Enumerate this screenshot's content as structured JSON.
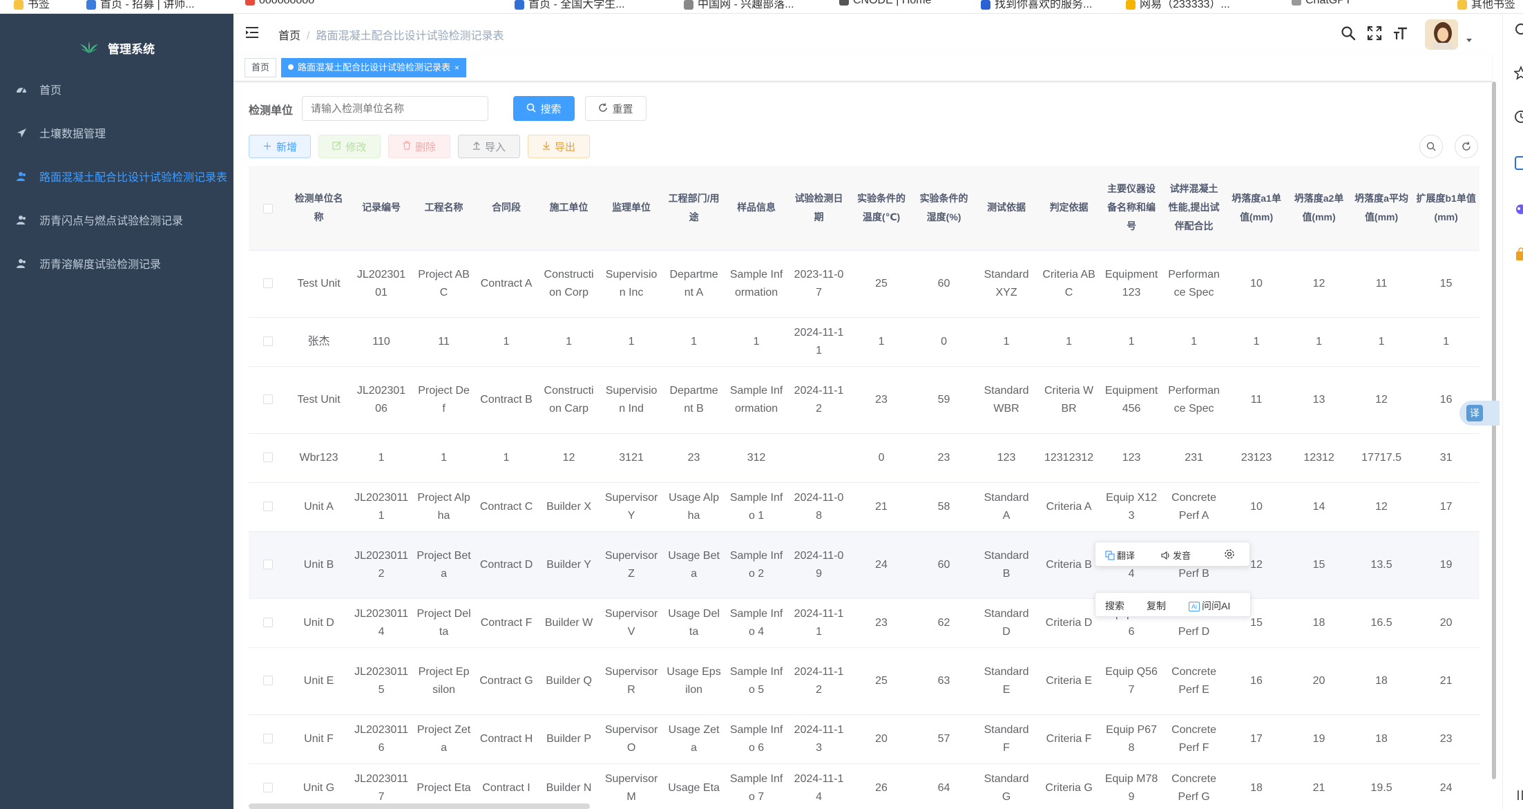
{
  "browser": {
    "bookmarks": [
      "书签",
      "首页 - 招募 | 讲师...",
      "ooooooooo",
      "首页 - 全国大学生...",
      "中国网 - 兴趣部落...",
      "CNODE | Home",
      "找到你喜欢的服务...",
      "网易（233333）...",
      "ChatGPT",
      "其他书签"
    ]
  },
  "sidebar": {
    "logo_text": "管理系统",
    "items": [
      {
        "label": "首页",
        "icon": "dashboard-icon"
      },
      {
        "label": "土壤数据管理",
        "icon": "send-icon"
      },
      {
        "label": "路面混凝土配合比设计试验检测记录表",
        "icon": "user-icon"
      },
      {
        "label": "沥青闪点与燃点试验检测记录",
        "icon": "user-icon"
      },
      {
        "label": "沥青溶解度试验检测记录",
        "icon": "user-icon"
      }
    ],
    "active_index": 2
  },
  "navbar": {
    "breadcrumb": [
      "首页",
      "路面混凝土配合比设计试验检测记录表"
    ]
  },
  "tags": [
    {
      "label": "首页",
      "active": false
    },
    {
      "label": "路面混凝土配合比设计试验检测记录表",
      "active": true
    }
  ],
  "search": {
    "label": "检测单位",
    "placeholder": "请输入检测单位名称",
    "search_label": "搜索",
    "reset_label": "重置"
  },
  "toolbar": {
    "add": "新增",
    "edit": "修改",
    "delete": "删除",
    "import": "导入",
    "export": "导出"
  },
  "table": {
    "columns": [
      "检测单位名称",
      "记录编号",
      "工程名称",
      "合同段",
      "施工单位",
      "监理单位",
      "工程部门/用途",
      "样品信息",
      "试验检测日期",
      "实验条件的温度(℃)",
      "实验条件的湿度(%)",
      "测试依据",
      "判定依据",
      "主要仪器设备名称和编号",
      "试拌混凝土性能,提出试伴配合比",
      "坍落度a1单值(mm)",
      "坍落度a2单值(mm)",
      "坍落度a平均值(mm)",
      "扩展度b1单值(mm)"
    ],
    "rows": [
      [
        "Test Unit",
        "JL20230101",
        "Project ABC",
        "Contract A",
        "Construction Corp",
        "Supervision Inc",
        "Department A",
        "Sample Information",
        "2023-11-07",
        "25",
        "60",
        "Standard XYZ",
        "Criteria ABC",
        "Equipment 123",
        "Performance Spec",
        "10",
        "12",
        "11",
        "15"
      ],
      [
        "张杰",
        "110",
        "11",
        "1",
        "1",
        "1",
        "1",
        "1",
        "2024-11-11",
        "1",
        "0",
        "1",
        "1",
        "1",
        "1",
        "1",
        "1",
        "1",
        "1"
      ],
      [
        "Test Unit",
        "JL20230106",
        "Project Def",
        "Contract B",
        "Construction Carp",
        "Supervision Ind",
        "Department B",
        "Sample Information",
        "2024-11-12",
        "23",
        "59",
        "Standard WBR",
        "Criteria WBR",
        "Equipment 456",
        "Performance Spec",
        "11",
        "13",
        "12",
        "16"
      ],
      [
        "Wbr123",
        "1",
        "1",
        "1",
        "12",
        "3121",
        "23",
        "312",
        "",
        "0",
        "23",
        "123",
        "12312312",
        "123",
        "231",
        "23123",
        "12312",
        "17717.5",
        "31"
      ],
      [
        "Unit A",
        "JL20230111",
        "Project Alpha",
        "Contract C",
        "Builder X",
        "Supervisor Y",
        "Usage Alpha",
        "Sample Info 1",
        "2024-11-08",
        "21",
        "58",
        "Standard A",
        "Criteria A",
        "Equip X123",
        "Concrete Perf A",
        "10",
        "14",
        "12",
        "17"
      ],
      [
        "Unit B",
        "JL20230112",
        "Project Beta",
        "Contract D",
        "Builder Y",
        "Supervisor Z",
        "Usage Beta",
        "Sample Info 2",
        "2024-11-09",
        "24",
        "60",
        "Standard B",
        "Criteria B",
        "Equip Y234",
        "Concrete Perf B",
        "12",
        "15",
        "13.5",
        "19"
      ],
      [
        "Unit D",
        "JL20230114",
        "Project Delta",
        "Contract F",
        "Builder W",
        "Supervisor V",
        "Usage Delta",
        "Sample Info 4",
        "2024-11-11",
        "23",
        "62",
        "Standard D",
        "Criteria D",
        "Equip W456",
        "Concrete Perf D",
        "15",
        "18",
        "16.5",
        "20"
      ],
      [
        "Unit E",
        "JL20230115",
        "Project Epsilon",
        "Contract G",
        "Builder Q",
        "Supervisor R",
        "Usage Epsilon",
        "Sample Info 5",
        "2024-11-12",
        "25",
        "63",
        "Standard E",
        "Criteria E",
        "Equip Q567",
        "Concrete Perf E",
        "16",
        "20",
        "18",
        "21"
      ],
      [
        "Unit F",
        "JL20230116",
        "Project Zeta",
        "Contract H",
        "Builder P",
        "Supervisor O",
        "Usage Zeta",
        "Sample Info 6",
        "2024-11-13",
        "20",
        "57",
        "Standard F",
        "Criteria F",
        "Equip P678",
        "Concrete Perf F",
        "17",
        "19",
        "18",
        "23"
      ],
      [
        "Unit G",
        "JL20230117",
        "Project Eta",
        "Contract I",
        "Builder N",
        "Supervisor M",
        "Usage Eta",
        "Sample Info 7",
        "2024-11-14",
        "26",
        "64",
        "Standard G",
        "Criteria G",
        "Equip M789",
        "Concrete Perf G",
        "18",
        "21",
        "19.5",
        "24"
      ]
    ],
    "highlight_row": 5
  },
  "popover": {
    "translate": "翻译",
    "speak": "发音",
    "search": "搜索",
    "copy": "复制",
    "ai": "问问AI",
    "ai_badge": "Ai"
  },
  "translate_float": "译",
  "colors": {
    "sidebar_bg": "#304156",
    "sidebar_text": "#bfcbd9",
    "primary": "#409eff",
    "header_bg": "#f8f8f9"
  }
}
